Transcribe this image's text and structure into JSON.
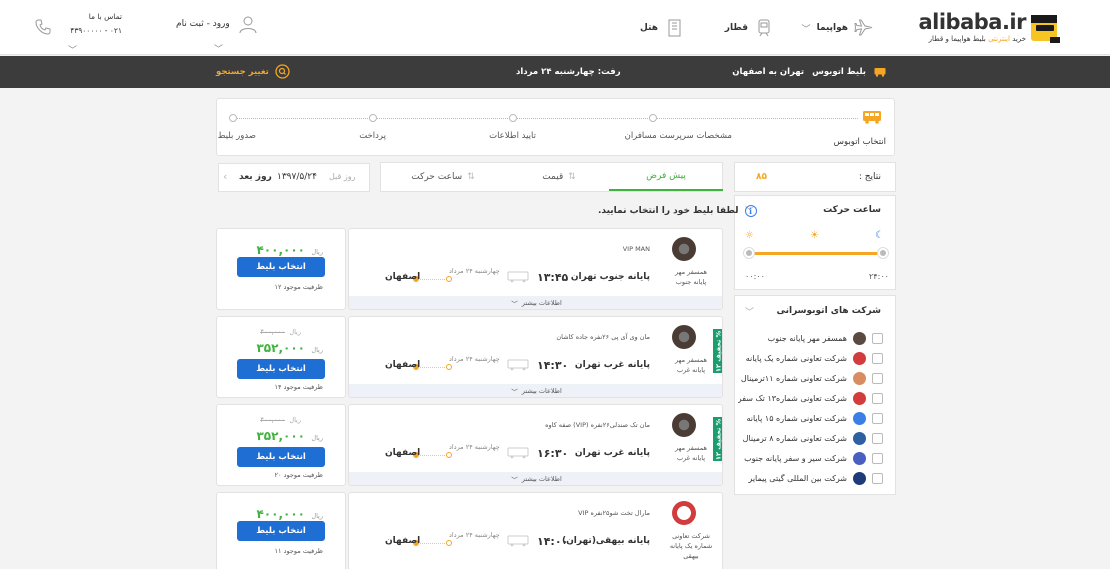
{
  "header": {
    "logo_word": "alibaba.ir",
    "logo_tagline_pre": "خرید",
    "logo_tagline_highlight": "اینترنتی",
    "logo_tagline_post": "بلیط هواپیما و قطار",
    "nav": {
      "flight": "هواپیما",
      "train": "قطار",
      "hotel": "هتل"
    },
    "login": "ورود - ثبت نام",
    "contact_label": "تماس با ما",
    "contact_number": "۰۲۱ - ۴۳۹۰۰۰۰۰"
  },
  "summary": {
    "ticket_type": "بلیط اتوبوس",
    "route": "تهران به اصفهان",
    "departure": "رفت: چهارشنبه ۲۴ مرداد",
    "change_search": "تغییر جستجو"
  },
  "stepper": {
    "steps": [
      "انتخاب اتوبوس",
      "مشخصات سرپرست مسافران",
      "تایید اطلاعات",
      "پرداخت",
      "صدور بلیط"
    ]
  },
  "tabs": {
    "default": "پیش فرض",
    "price": "قیمت",
    "departure_time": "ساعت حرکت"
  },
  "datenav": {
    "prev_day": "روز قبل",
    "current_date": "۱۳۹۷/۵/۲۴",
    "next_day": "روز بعد"
  },
  "results": {
    "label": "نتایج :",
    "count": "۸۵"
  },
  "time_filter": {
    "title": "ساعت حرکت",
    "min": "۰۰:۰۰",
    "max": "۲۴:۰۰",
    "range_min_fraction": 0,
    "range_max_fraction": 1
  },
  "company_filter": {
    "title": "شرکت های اتوبوسرانی",
    "companies": [
      {
        "name": "همسفر مهر پایانه  جنوب",
        "color": "#5a4a42"
      },
      {
        "name": "شرکت تعاونی شماره یک پایانه",
        "color": "#d23c3c"
      },
      {
        "name": "شرکت تعاونی شماره ۱۱ترمینال",
        "color": "#d98c5f"
      },
      {
        "name": "شرکت تعاونی شماره۱۳ تک سفر",
        "color": "#d23c3c"
      },
      {
        "name": "شرکت تعاونی شماره ۱۵ پایانه",
        "color": "#3b7fe6"
      },
      {
        "name": "شرکت تعاونی شماره ۸ ترمینال",
        "color": "#2e5fa3"
      },
      {
        "name": "شرکت سیر و سفر پایانه جنوب",
        "color": "#4a5fc1"
      },
      {
        "name": "شرکت بین المللی گیتی پیمایر",
        "color": "#1f3a78"
      }
    ]
  },
  "prompt": {
    "info_glyph": "i",
    "text": "لطفا بلیط خود را انتخاب نمایید."
  },
  "cards": [
    {
      "operator": "همسفر مهر پایانه جنوب",
      "bus_type": "VIP MAN",
      "origin": "پایانه جنوب تهران",
      "time": "۱۳:۴۵",
      "date": "چهارشنبه ۲۴ مرداد",
      "destination": "اصفهان",
      "price": "۴۰۰,۰۰۰",
      "old_price": "",
      "discount": "",
      "currency": "ریال",
      "capacity": "ظرفیت موجود ۱۲",
      "select": "انتخاب بلیط",
      "more_info": "اطلاعات بیشتر"
    },
    {
      "operator": "همسفر مهر پایانه غرب",
      "bus_type": "مان وی آی پی ۲۶نفره جاده کاشان",
      "origin": "پایانه غرب تهران",
      "time": "۱۴:۳۰",
      "date": "چهارشنبه ۲۴ مرداد",
      "destination": "اصفهان",
      "price": "۳۵۲,۰۰۰",
      "old_price": "۴۰۰,۰۰۰",
      "discount": "تخفیف ۱۲ %",
      "currency": "ریال",
      "capacity": "ظرفیت موجود ۱۴",
      "select": "انتخاب بلیط",
      "more_info": "اطلاعات بیشتر"
    },
    {
      "operator": "همسفر مهر پایانه غرب",
      "bus_type": "مان تک صندلی۲۶نفره (VIP) صفه کاوه",
      "origin": "پایانه غرب تهران",
      "time": "۱۶:۳۰",
      "date": "چهارشنبه ۲۴ مرداد",
      "destination": "اصفهان",
      "price": "۳۵۲,۰۰۰",
      "old_price": "۴۰۰,۰۰۰",
      "discount": "تخفیف ۱۲ %",
      "currency": "ریال",
      "capacity": "ظرفیت موجود ۲۰",
      "select": "انتخاب بلیط",
      "more_info": "اطلاعات بیشتر"
    },
    {
      "operator": "شرکت تعاونی شماره یک پایانه بیهقی",
      "bus_type": "مارال تخت شو۲۵نفره VIP",
      "origin": "پایانه بیهقی(تهران)",
      "time": "۱۴:۰۰",
      "date": "چهارشنبه ۲۴ مرداد",
      "destination": "اصفهان",
      "price": "۴۰۰,۰۰۰",
      "old_price": "",
      "discount": "",
      "currency": "ریال",
      "capacity": "ظرفیت موجود ۱۱",
      "select": "انتخاب بلیط",
      "more_info": ""
    }
  ]
}
